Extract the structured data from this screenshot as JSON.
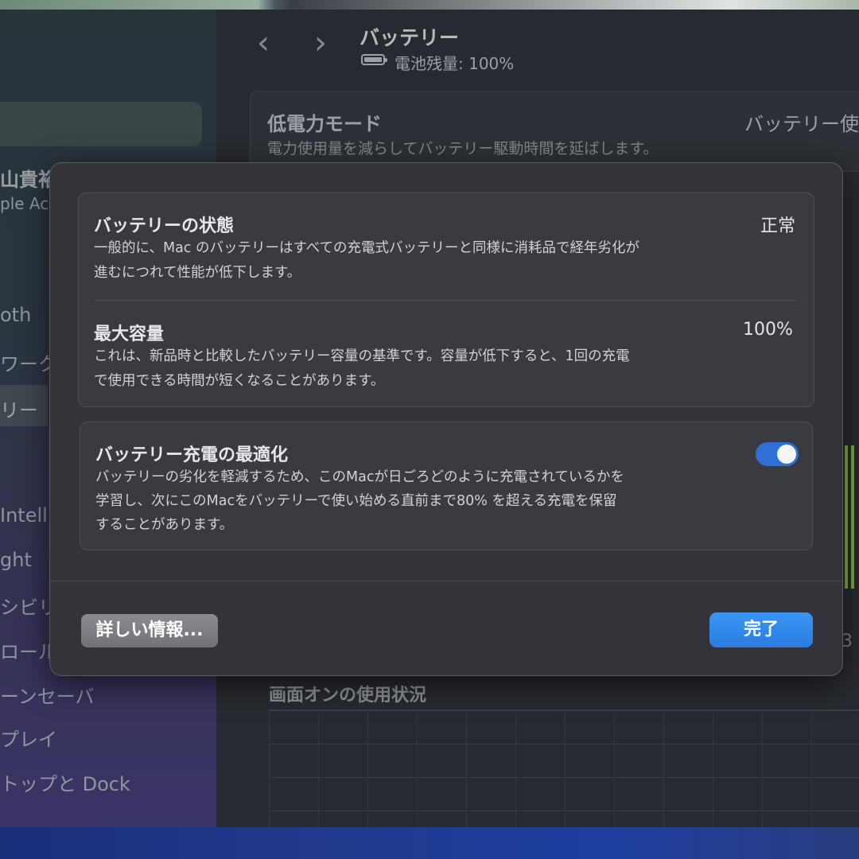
{
  "sidebar": {
    "name_fragment": "山貴裕",
    "account_fragment": "ple Ac",
    "items": [
      "oth",
      "ワーク",
      "リー",
      "Intell",
      "ght",
      "シビリ",
      "ロール",
      "ーンセーバ",
      "プレイ",
      "トップと Dock"
    ]
  },
  "main": {
    "title": "バッテリー",
    "battery_level": "電池残量: 100%",
    "low_power": {
      "label": "低電力モード",
      "description": "電力使用量を減らしてバッテリー駆動時間を延ばします。",
      "right_fragment": "バッテリー使"
    },
    "usage_title": "画面オンの使用状況",
    "right_fragment_number": "3"
  },
  "dialog": {
    "health": {
      "title": "バッテリーの状態",
      "value": "正常",
      "description_line1": "一般的に、Mac のバッテリーはすべての充電式バッテリーと同様に消耗品で経年劣化が",
      "description_line2": "進むにつれて性能が低下します。"
    },
    "capacity": {
      "title": "最大容量",
      "value": "100%",
      "description_line1": "これは、新品時と比較したバッテリー容量の基準です。容量が低下すると、1回の充電",
      "description_line2": "で使用できる時間が短くなることがあります。"
    },
    "optimized_charging": {
      "title": "バッテリー充電の最適化",
      "enabled": true,
      "description_line1": "バッテリーの劣化を軽減するため、このMacが日ごろどのように充電されているかを",
      "description_line2": "学習し、次にこのMacをバッテリーで使い始める直前まで80% を超える充電を保留",
      "description_line3": "することがあります。"
    },
    "more_info_label": "詳しい情報...",
    "done_label": "完了"
  },
  "colors": {
    "accent": "#2f6fd6",
    "done_button": "#3b95f3",
    "dialog_bg": "#333339"
  }
}
